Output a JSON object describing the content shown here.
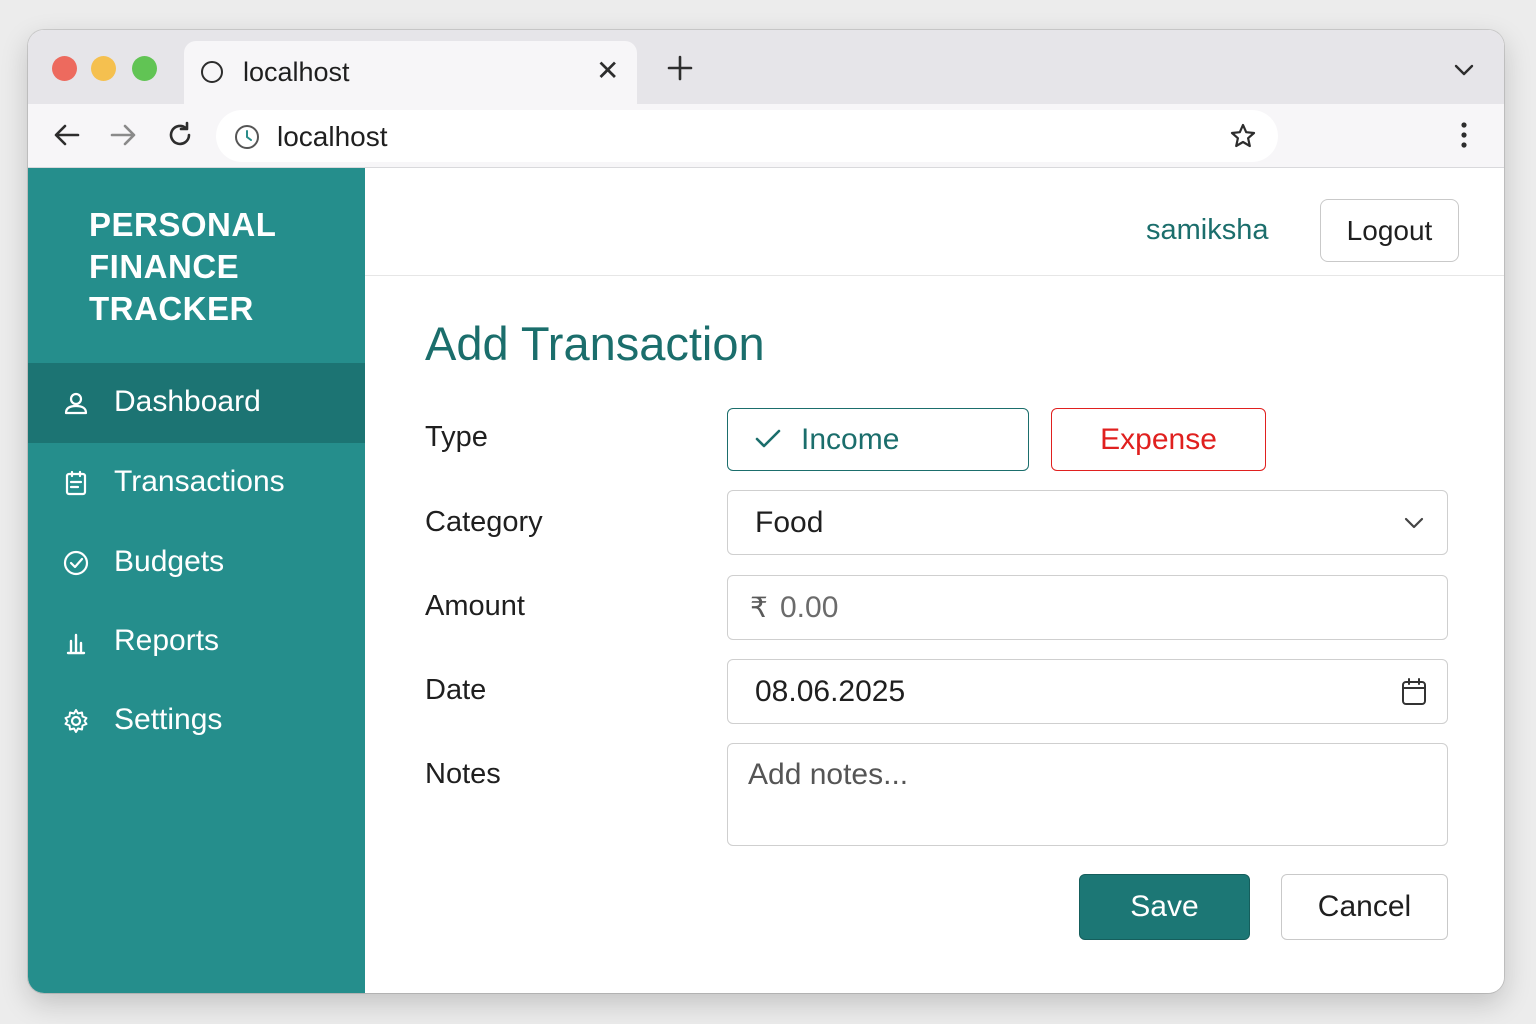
{
  "browser": {
    "tab_title": "localhost",
    "url": "localhost"
  },
  "colors": {
    "sidebar": "#258e8c",
    "sidebar_active": "#1c7473",
    "accent": "#1b6e6c",
    "expense": "#e0201f"
  },
  "sidebar": {
    "brand_lines": [
      "PERSONAL",
      "FINANCE",
      "TRACKER"
    ],
    "items": [
      {
        "label": "Dashboard",
        "icon": "user-icon",
        "active": true
      },
      {
        "label": "Transactions",
        "icon": "clipboard-icon",
        "active": false
      },
      {
        "label": "Budgets",
        "icon": "check-circle-icon",
        "active": false
      },
      {
        "label": "Reports",
        "icon": "bar-chart-icon",
        "active": false
      },
      {
        "label": "Settings",
        "icon": "gear-icon",
        "active": false
      }
    ]
  },
  "header": {
    "username": "samiksha",
    "logout_label": "Logout"
  },
  "form": {
    "title": "Add Transaction",
    "type": {
      "label": "Type",
      "income_label": "Income",
      "expense_label": "Expense",
      "selected": "Income"
    },
    "category": {
      "label": "Category",
      "value": "Food"
    },
    "amount": {
      "label": "Amount",
      "currency": "₹",
      "placeholder": "0.00"
    },
    "date": {
      "label": "Date",
      "value": "08.06.2025"
    },
    "notes": {
      "label": "Notes",
      "placeholder": "Add notes..."
    },
    "save_label": "Save",
    "cancel_label": "Cancel"
  }
}
